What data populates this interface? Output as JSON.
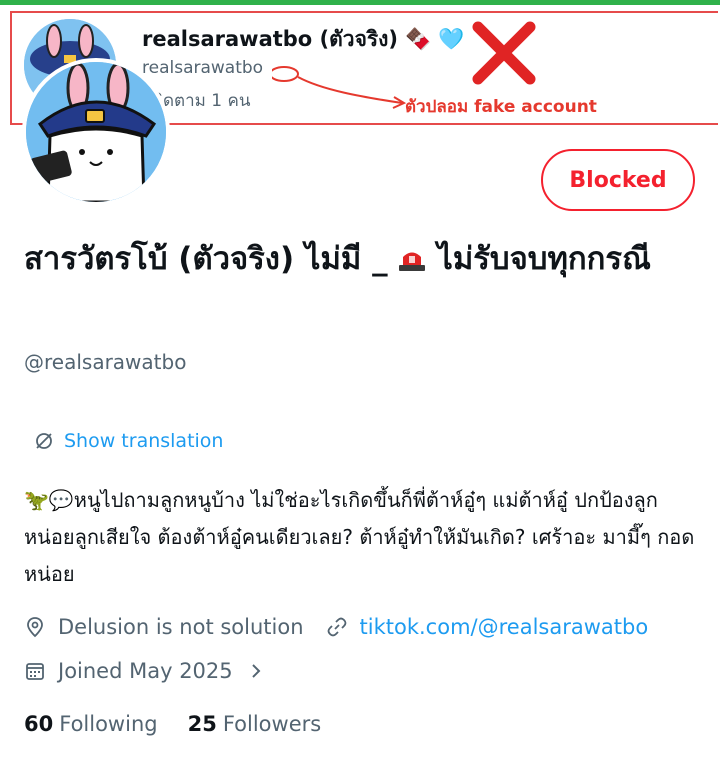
{
  "inset": {
    "name": "realsarawatbo (ตัวจริง)",
    "name_emojis": "🍫 🩵",
    "handle": "realsarawatbo",
    "following_text": "ผู้ติดตาม 1 คน",
    "annotation": "ตัวปลอม fake account"
  },
  "profile": {
    "blocked_label": "Blocked",
    "display_name_part1": "สารวัตรโบ้ (ตัวจริง) ไม่มี _ ",
    "display_name_part2": " ไม่รับจบทุกกรณี",
    "handle": "@realsarawatbo",
    "show_translation": "Show translation",
    "bio": "🦖💬หนูไปถามลูกหนูบ้าง ไม่ใช่อะไรเกิดขึ้นก็พี่ต้าห์อู๋ๆ แม่ต้าห์อู๋ ปกป้องลูกหน่อยลูกเสียใจ ต้องต้าห์อู๋คนเดียวเลย? ต้าห์อู๋ทำให้มันเกิด? เศร้าอะ มามี๊ๆ กอดหน่อย",
    "location": "Delusion is not solution",
    "website": "tiktok.com/@realsarawatbo",
    "joined": "Joined May 2025",
    "following_count": "60",
    "following_label": "Following",
    "followers_count": "25",
    "followers_label": "Followers"
  },
  "colors": {
    "accent_blue": "#1d9bf0",
    "blocked_red": "#f4212e",
    "annotation_red": "#e5392e",
    "secondary_text": "#536471"
  },
  "icons": [
    "location-icon",
    "link-icon",
    "calendar-icon",
    "chevron-right-icon",
    "translate-icon",
    "siren-icon",
    "x-mark-icon"
  ]
}
